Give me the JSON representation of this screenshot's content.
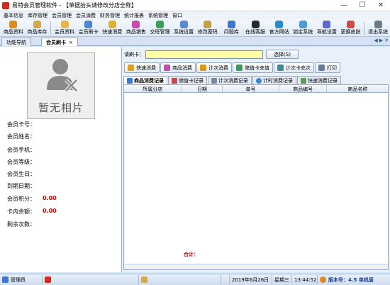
{
  "window": {
    "title": "易特会员管理软件 - 【单据抬头请修改分店全称】"
  },
  "menu": [
    "基本信息",
    "库存管理",
    "会员管理",
    "会员消费",
    "财务管理",
    "统计报表",
    "系统管理",
    "窗口"
  ],
  "toolbar": [
    {
      "label": "商品资料",
      "icon": "product-info-icon",
      "color": "#e08a1e"
    },
    {
      "label": "商品库存",
      "icon": "inventory-icon",
      "color": "#d6a84a"
    },
    {
      "label": "会员资料",
      "icon": "member-info-icon",
      "color": "#e6b84a"
    },
    {
      "label": "会员刷卡",
      "icon": "swipe-card-icon",
      "color": "#4a88d4"
    },
    {
      "label": "快速消费",
      "icon": "quick-consume-icon",
      "color": "#e0b030"
    },
    {
      "label": "商品销售",
      "icon": "product-sales-icon",
      "color": "#c84ab0"
    },
    {
      "label": "交班管理",
      "icon": "shift-icon",
      "color": "#3aa05a"
    },
    {
      "label": "系统设置",
      "icon": "settings-icon",
      "color": "#5a8ad0"
    },
    {
      "label": "修改密码",
      "icon": "password-icon",
      "color": "#c8a040"
    },
    {
      "label": "问题库",
      "icon": "faq-icon",
      "color": "#3a78d0"
    },
    {
      "label": "在线客服",
      "icon": "support-icon",
      "color": "#2a2a2a"
    },
    {
      "label": "官方网站",
      "icon": "website-icon",
      "color": "#2a8ad0"
    },
    {
      "label": "锁定系统",
      "icon": "lock-icon",
      "color": "#4a9ad8"
    },
    {
      "label": "导航设置",
      "icon": "nav-settings-icon",
      "color": "#5a6ad0"
    },
    {
      "label": "更换皮肤",
      "icon": "skin-icon",
      "color": "#d04a4a"
    },
    {
      "label": "退出系统",
      "icon": "exit-icon",
      "color": "#6a7a8a"
    }
  ],
  "tabs": [
    {
      "label": "功能导航"
    },
    {
      "label": "会员刷卡",
      "active": true
    }
  ],
  "photo": {
    "caption": "暂无相片"
  },
  "member_fields": [
    {
      "label": "会员卡号："
    },
    {
      "label": "会员姓名："
    },
    {
      "label": "会员手机："
    },
    {
      "label": "会员等级："
    },
    {
      "label": "会员生日："
    },
    {
      "label": "到期日期："
    },
    {
      "label": "会员积分：",
      "value": "0.00"
    },
    {
      "label": "卡内余额：",
      "value": "0.00"
    },
    {
      "label": "剩余次数："
    }
  ],
  "swipe": {
    "label": "请刷卡：",
    "value": "",
    "select_label": "选择(S)"
  },
  "actions": [
    {
      "label": "快速消费",
      "icon": "quick-consume-icon",
      "color": "#e0a020"
    },
    {
      "label": "商品消费",
      "icon": "product-consume-icon",
      "color": "#c84ab0"
    },
    {
      "label": "计次消费",
      "icon": "count-consume-icon",
      "color": "#e09a10"
    },
    {
      "label": "储值卡充值",
      "icon": "recharge-icon",
      "color": "#3a9a5a"
    },
    {
      "label": "计次卡充次",
      "icon": "count-recharge-icon",
      "color": "#3a8a9a"
    },
    {
      "label": "打印",
      "icon": "print-icon",
      "color": "#6a7a9a"
    }
  ],
  "record_tabs": [
    {
      "label": "商品消费记录",
      "icon": "chart-icon",
      "color": "#3a7ad0",
      "active": true
    },
    {
      "label": "储值卡记录",
      "icon": "card-icon",
      "color": "#c84a4a"
    },
    {
      "label": "计次消费记录",
      "icon": "count-icon",
      "color": "#7a8aa0"
    },
    {
      "label": "计时消费记录",
      "icon": "clock-icon",
      "color": "#3a8ad0"
    },
    {
      "label": "快速消费记录",
      "icon": "quick-icon",
      "color": "#5a9a5a"
    }
  ],
  "grid_columns": [
    "所属分店",
    "日期",
    "单号",
    "商品编号",
    "商品名称"
  ],
  "total_label": "合计：",
  "status": {
    "user": "管理员",
    "date": "2019年6月26日",
    "weekday": "星期三",
    "time": "13:44:52",
    "version": "版本号：4.5 单机版"
  }
}
